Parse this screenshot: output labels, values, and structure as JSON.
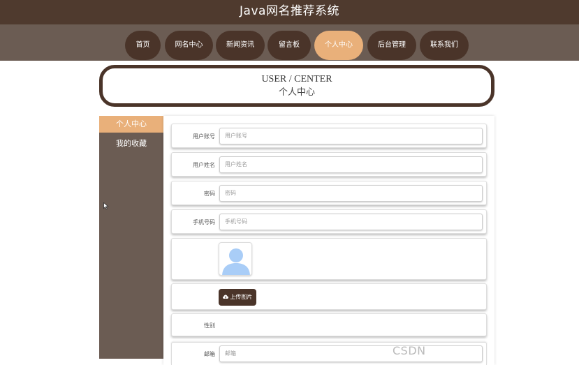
{
  "header": {
    "title": "Java网名推荐系统"
  },
  "nav": {
    "items": [
      {
        "label": "首页"
      },
      {
        "label": "网名中心"
      },
      {
        "label": "新闻资讯"
      },
      {
        "label": "留言板"
      },
      {
        "label": "个人中心"
      },
      {
        "label": "后台管理"
      },
      {
        "label": "联系我们"
      }
    ],
    "active_index": 4
  },
  "banner": {
    "en": "USER / CENTER",
    "cn": "个人中心"
  },
  "sidebar": {
    "items": [
      {
        "label": "个人中心"
      },
      {
        "label": "我的收藏"
      }
    ]
  },
  "form": {
    "account": {
      "label": "用户账号",
      "placeholder": "用户账号"
    },
    "name": {
      "label": "用户姓名",
      "placeholder": "用户姓名"
    },
    "password": {
      "label": "密码",
      "placeholder": "密码"
    },
    "phone": {
      "label": "手机号码",
      "placeholder": "手机号码"
    },
    "avatar_icon": "user-avatar-icon",
    "upload_label": "上传图片",
    "upload_icon": "cloud-upload-icon",
    "gender": {
      "label": "性别"
    },
    "email": {
      "label": "邮箱",
      "placeholder": "邮箱"
    }
  },
  "watermark": {
    "text": "CSDN"
  },
  "colors": {
    "header_bg": "#4f3a2e",
    "nav_bg": "#6b5c53",
    "button": "#4a3429",
    "accent": "#e9b07a"
  }
}
